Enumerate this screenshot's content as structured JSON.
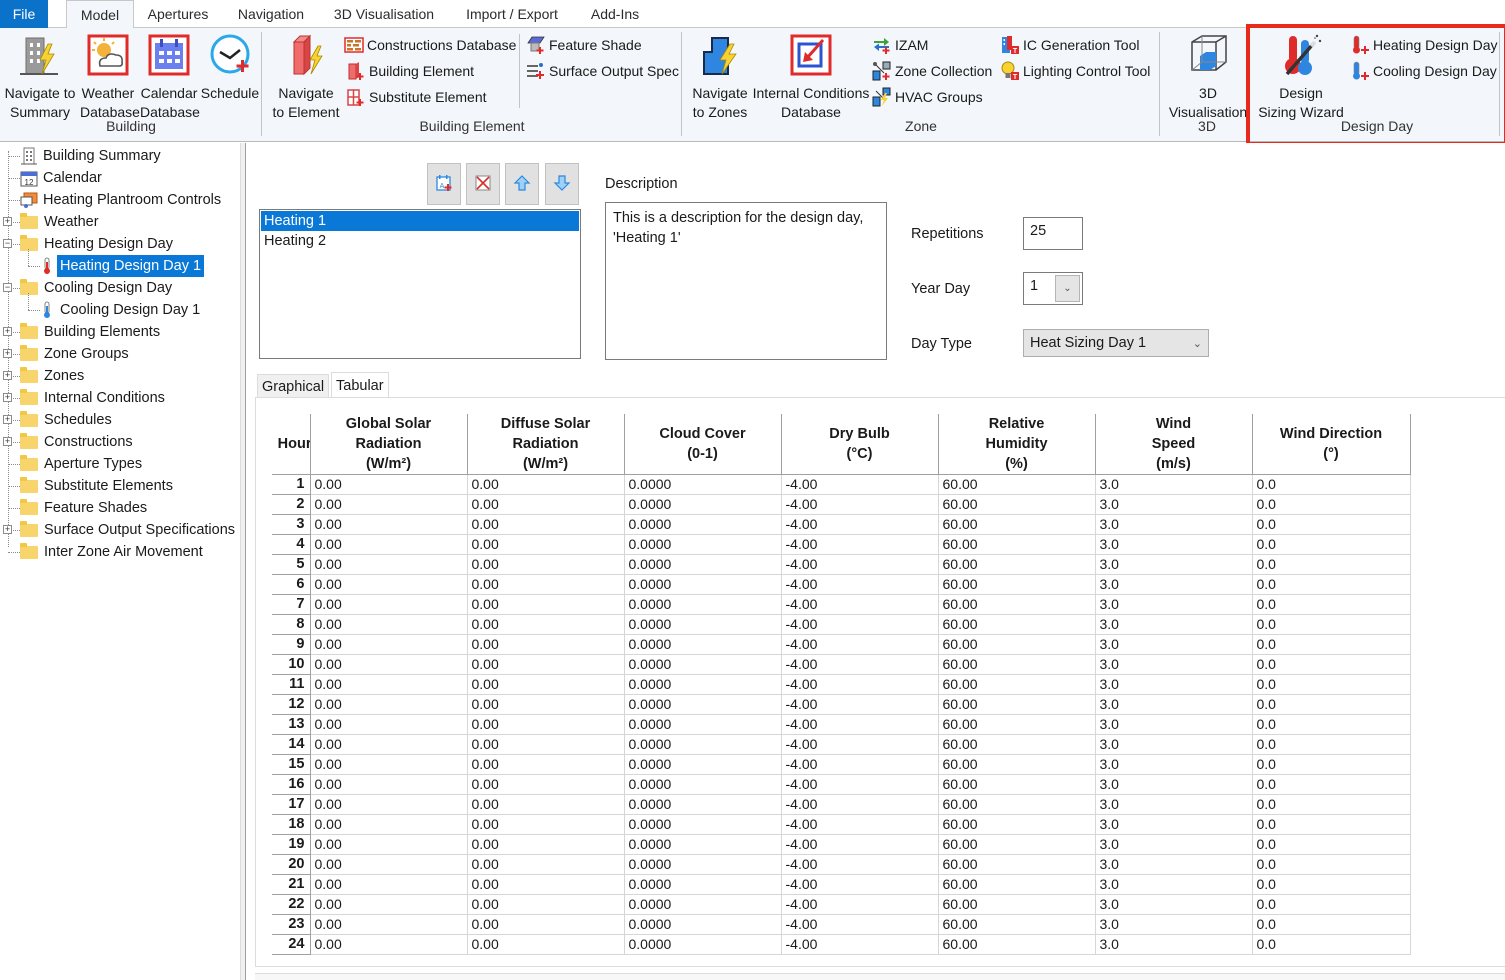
{
  "tabs": [
    {
      "label": "File"
    },
    {
      "label": "Model"
    },
    {
      "label": "Apertures"
    },
    {
      "label": "Navigation"
    },
    {
      "label": "3D Visualisation"
    },
    {
      "label": "Import / Export"
    },
    {
      "label": "Add-Ins"
    }
  ],
  "active_tab": "Model",
  "ribbon": {
    "building": {
      "label": "Building",
      "navigate_summary": "Navigate to Summary",
      "navigate_summary_l1": "Navigate to",
      "navigate_summary_l2": "Summary",
      "weather_l1": "Weather",
      "weather_l2": "Database",
      "calendar_l1": "Calendar",
      "calendar_l2": "Database",
      "schedule": "Schedule"
    },
    "building_element": {
      "label": "Building Element",
      "navigate_l1": "Navigate",
      "navigate_l2": "to Element",
      "constructions_db": "Constructions Database",
      "building_element": "Building Element",
      "substitute_element": "Substitute Element",
      "feature_shade": "Feature Shade",
      "surface_output_spec": "Surface Output Spec"
    },
    "zone": {
      "label": "Zone",
      "navigate_l1": "Navigate",
      "navigate_l2": "to Zones",
      "ic_db_l1": "Internal Conditions",
      "ic_db_l2": "Database",
      "izam": "IZAM",
      "zone_collection": "Zone Collection",
      "hvac_groups": "HVAC Groups",
      "ic_generation": "IC Generation Tool",
      "lighting_control": "Lighting Control Tool"
    },
    "viz3d": {
      "label": "3D",
      "btn_l1": "3D",
      "btn_l2": "Visualisation"
    },
    "design_day": {
      "label": "Design Day",
      "wizard_l1": "Design",
      "wizard_l2": "Sizing Wizard",
      "heating": "Heating Design Day",
      "cooling": "Cooling Design Day"
    }
  },
  "tree": {
    "items": [
      {
        "label": "Building Summary",
        "icon": "building-icon",
        "expander": ""
      },
      {
        "label": "Calendar",
        "icon": "calendar-icon",
        "expander": ""
      },
      {
        "label": "Heating Plantroom Controls",
        "icon": "plantroom-icon",
        "expander": ""
      },
      {
        "label": "Weather",
        "icon": "folder-icon",
        "expander": "+"
      },
      {
        "label": "Heating Design Day",
        "icon": "folder-icon",
        "expander": "−"
      },
      {
        "label": "Heating Design Day 1",
        "icon": "thermometer-red-icon",
        "expander": "",
        "selected": true
      },
      {
        "label": "Cooling Design Day",
        "icon": "folder-icon",
        "expander": "−"
      },
      {
        "label": "Cooling Design Day 1",
        "icon": "thermometer-blue-icon",
        "expander": ""
      },
      {
        "label": "Building Elements",
        "icon": "folder-icon",
        "expander": "+"
      },
      {
        "label": "Zone Groups",
        "icon": "folder-icon",
        "expander": "+"
      },
      {
        "label": "Zones",
        "icon": "folder-icon",
        "expander": "+"
      },
      {
        "label": "Internal Conditions",
        "icon": "folder-icon",
        "expander": "+"
      },
      {
        "label": "Schedules",
        "icon": "folder-icon",
        "expander": "+"
      },
      {
        "label": "Constructions",
        "icon": "folder-icon",
        "expander": "+"
      },
      {
        "label": "Aperture Types",
        "icon": "folder-icon",
        "expander": ""
      },
      {
        "label": "Substitute Elements",
        "icon": "folder-icon",
        "expander": ""
      },
      {
        "label": "Feature Shades",
        "icon": "folder-icon",
        "expander": ""
      },
      {
        "label": "Surface Output Specifications",
        "icon": "folder-icon",
        "expander": "+"
      },
      {
        "label": "Inter Zone Air Movement",
        "icon": "folder-icon",
        "expander": ""
      }
    ]
  },
  "main": {
    "toolbar": {
      "add": "add-design-day-icon",
      "delete": "delete-icon",
      "up": "move-up-icon",
      "down": "move-down-icon"
    },
    "design_days": [
      {
        "label": "Heating 1",
        "selected": true
      },
      {
        "label": "Heating 2",
        "selected": false
      }
    ],
    "description_label": "Description",
    "description": "This is a description for the design day, 'Heating 1'",
    "repetitions_label": "Repetitions",
    "repetitions": "25",
    "year_day_label": "Year Day",
    "year_day": "1",
    "day_type_label": "Day Type",
    "day_type": "Heat Sizing Day 1",
    "subtabs": [
      "Graphical",
      "Tabular"
    ],
    "active_subtab": "Tabular"
  },
  "table": {
    "hour_header": "Hour",
    "columns": [
      [
        "Global Solar",
        "Radiation",
        "(W/m²)"
      ],
      [
        "Diffuse Solar",
        "Radiation",
        "(W/m²)"
      ],
      [
        "Cloud Cover",
        "(0-1)"
      ],
      [
        "Dry Bulb",
        "(°C)"
      ],
      [
        "Relative",
        "Humidity",
        "(%)"
      ],
      [
        "Wind",
        "Speed",
        "(m/s)"
      ],
      [
        "Wind Direction",
        "(°)"
      ]
    ],
    "rows": [
      {
        "hour": "1",
        "values": [
          "0.00",
          "0.00",
          "0.0000",
          "-4.00",
          "60.00",
          "3.0",
          "0.0"
        ]
      },
      {
        "hour": "2",
        "values": [
          "0.00",
          "0.00",
          "0.0000",
          "-4.00",
          "60.00",
          "3.0",
          "0.0"
        ]
      },
      {
        "hour": "3",
        "values": [
          "0.00",
          "0.00",
          "0.0000",
          "-4.00",
          "60.00",
          "3.0",
          "0.0"
        ]
      },
      {
        "hour": "4",
        "values": [
          "0.00",
          "0.00",
          "0.0000",
          "-4.00",
          "60.00",
          "3.0",
          "0.0"
        ]
      },
      {
        "hour": "5",
        "values": [
          "0.00",
          "0.00",
          "0.0000",
          "-4.00",
          "60.00",
          "3.0",
          "0.0"
        ]
      },
      {
        "hour": "6",
        "values": [
          "0.00",
          "0.00",
          "0.0000",
          "-4.00",
          "60.00",
          "3.0",
          "0.0"
        ]
      },
      {
        "hour": "7",
        "values": [
          "0.00",
          "0.00",
          "0.0000",
          "-4.00",
          "60.00",
          "3.0",
          "0.0"
        ]
      },
      {
        "hour": "8",
        "values": [
          "0.00",
          "0.00",
          "0.0000",
          "-4.00",
          "60.00",
          "3.0",
          "0.0"
        ]
      },
      {
        "hour": "9",
        "values": [
          "0.00",
          "0.00",
          "0.0000",
          "-4.00",
          "60.00",
          "3.0",
          "0.0"
        ]
      },
      {
        "hour": "10",
        "values": [
          "0.00",
          "0.00",
          "0.0000",
          "-4.00",
          "60.00",
          "3.0",
          "0.0"
        ]
      },
      {
        "hour": "11",
        "values": [
          "0.00",
          "0.00",
          "0.0000",
          "-4.00",
          "60.00",
          "3.0",
          "0.0"
        ]
      },
      {
        "hour": "12",
        "values": [
          "0.00",
          "0.00",
          "0.0000",
          "-4.00",
          "60.00",
          "3.0",
          "0.0"
        ]
      },
      {
        "hour": "13",
        "values": [
          "0.00",
          "0.00",
          "0.0000",
          "-4.00",
          "60.00",
          "3.0",
          "0.0"
        ]
      },
      {
        "hour": "14",
        "values": [
          "0.00",
          "0.00",
          "0.0000",
          "-4.00",
          "60.00",
          "3.0",
          "0.0"
        ]
      },
      {
        "hour": "15",
        "values": [
          "0.00",
          "0.00",
          "0.0000",
          "-4.00",
          "60.00",
          "3.0",
          "0.0"
        ]
      },
      {
        "hour": "16",
        "values": [
          "0.00",
          "0.00",
          "0.0000",
          "-4.00",
          "60.00",
          "3.0",
          "0.0"
        ]
      },
      {
        "hour": "17",
        "values": [
          "0.00",
          "0.00",
          "0.0000",
          "-4.00",
          "60.00",
          "3.0",
          "0.0"
        ]
      },
      {
        "hour": "18",
        "values": [
          "0.00",
          "0.00",
          "0.0000",
          "-4.00",
          "60.00",
          "3.0",
          "0.0"
        ]
      },
      {
        "hour": "19",
        "values": [
          "0.00",
          "0.00",
          "0.0000",
          "-4.00",
          "60.00",
          "3.0",
          "0.0"
        ]
      },
      {
        "hour": "20",
        "values": [
          "0.00",
          "0.00",
          "0.0000",
          "-4.00",
          "60.00",
          "3.0",
          "0.0"
        ]
      },
      {
        "hour": "21",
        "values": [
          "0.00",
          "0.00",
          "0.0000",
          "-4.00",
          "60.00",
          "3.0",
          "0.0"
        ]
      },
      {
        "hour": "22",
        "values": [
          "0.00",
          "0.00",
          "0.0000",
          "-4.00",
          "60.00",
          "3.0",
          "0.0"
        ]
      },
      {
        "hour": "23",
        "values": [
          "0.00",
          "0.00",
          "0.0000",
          "-4.00",
          "60.00",
          "3.0",
          "0.0"
        ]
      },
      {
        "hour": "24",
        "values": [
          "0.00",
          "0.00",
          "0.0000",
          "-4.00",
          "60.00",
          "3.0",
          "0.0"
        ]
      }
    ]
  },
  "colors": {
    "accent": "#0a78d7",
    "file_tab": "#0a72c9",
    "highlight_box": "#e82a1c",
    "ribbon_bg": "#f3f6fa"
  }
}
